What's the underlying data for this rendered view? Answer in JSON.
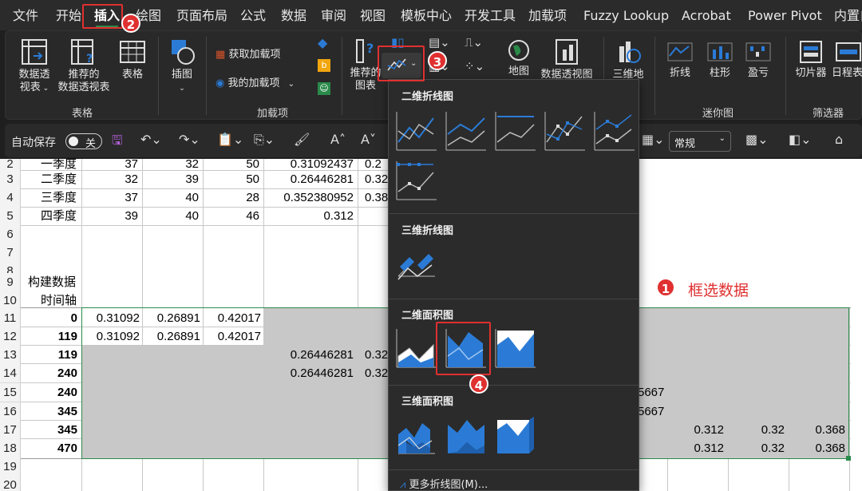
{
  "menubar": {
    "tabs": [
      "文件",
      "开始",
      "插入",
      "绘图",
      "页面布局",
      "公式",
      "数据",
      "审阅",
      "视图",
      "模板中心",
      "开发工具",
      "加载项",
      "Fuzzy Lookup",
      "Acrobat",
      "Power Pivot",
      "内置自"
    ],
    "active": "插入"
  },
  "ribbon": {
    "pivot_table": "数据透\n视表",
    "recommended_pivot": "推荐的\n数据透视表",
    "table": "表格",
    "illustrations": "插图",
    "get_addins": "获取加载项",
    "my_addins": "我的加载项",
    "recommended_charts": "推荐的\n图表",
    "map": "地图",
    "pivot_chart": "数据透视图",
    "map3d": "三维地",
    "spark_line": "折线",
    "spark_column": "柱形",
    "spark_winloss": "盈亏",
    "slicer": "切片器",
    "timeline": "日程表",
    "group_tables": "表格",
    "group_addins": "加载项",
    "group_sparklines": "迷你图",
    "group_filters": "筛选器"
  },
  "qat": {
    "autosave_label": "自动保存",
    "toggle_text": "关",
    "number_format": "常规"
  },
  "sheet": {
    "row_headers": [
      "2",
      "3",
      "4",
      "5",
      "6",
      "7",
      "8",
      "9",
      "10",
      "11",
      "12",
      "13",
      "14",
      "15",
      "16",
      "17",
      "18",
      "19",
      "20"
    ],
    "top_rows": [
      {
        "label": "一季度",
        "b": "37",
        "c": "32",
        "d": "50",
        "e": "0.31092437",
        "f": "0.2"
      },
      {
        "label": "二季度",
        "b": "32",
        "c": "39",
        "d": "50",
        "e": "0.26446281",
        "f": "0.32"
      },
      {
        "label": "三季度",
        "b": "37",
        "c": "40",
        "d": "28",
        "e": "0.352380952",
        "f": "0.38"
      },
      {
        "label": "四季度",
        "b": "39",
        "c": "40",
        "d": "46",
        "e": "0.312",
        "f": ""
      }
    ],
    "label_build": "构建数据",
    "label_axis": "时间轴",
    "axis_values": [
      "0",
      "119",
      "119",
      "240",
      "240",
      "345",
      "345",
      "470"
    ],
    "row11": [
      "0.31092",
      "0.26891",
      "0.42017"
    ],
    "row12": [
      "0.31092",
      "0.26891",
      "0.42017"
    ],
    "row13": [
      "0.26446281",
      "0.32"
    ],
    "row14": [
      "0.26446281",
      "0.32"
    ],
    "row15_tail": "5667",
    "row16_tail": "5667",
    "row17": [
      "0.312",
      "0.32",
      "0.368"
    ],
    "row18": [
      "0.312",
      "0.32",
      "0.368"
    ]
  },
  "dropdown": {
    "section_2d_line": "二维折线图",
    "section_3d_line": "三维折线图",
    "section_2d_area": "二维面积图",
    "section_3d_area": "三维面积图",
    "more": "更多折线图(M)..."
  },
  "annotations": {
    "badges": [
      "1",
      "2",
      "3",
      "4"
    ],
    "select_data_text": "框选数据"
  },
  "colors": {
    "accent_blue": "#2b7bd6",
    "annotation_red": "#e03030",
    "selection_green": "#2a8a4a"
  }
}
